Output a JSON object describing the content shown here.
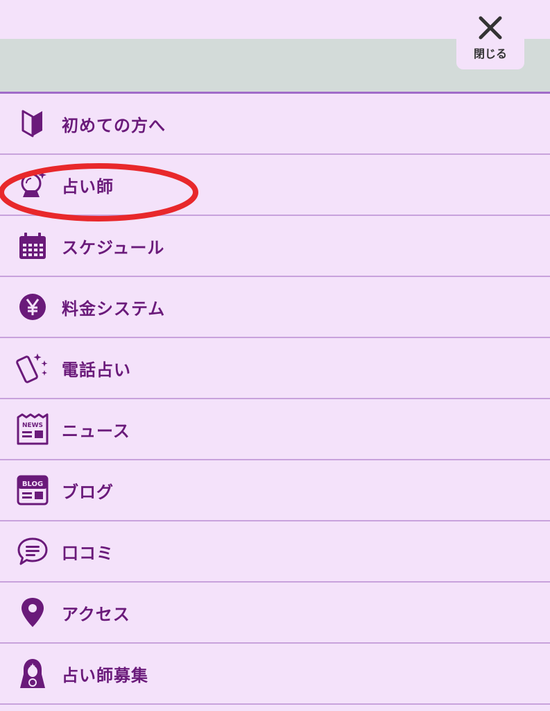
{
  "header": {
    "close_label": "閉じる"
  },
  "menu": {
    "items": [
      {
        "label": "初めての方へ",
        "icon": "beginner-mark-icon"
      },
      {
        "label": "占い師",
        "icon": "crystal-ball-icon"
      },
      {
        "label": "スケジュール",
        "icon": "calendar-icon"
      },
      {
        "label": "料金システム",
        "icon": "yen-icon"
      },
      {
        "label": "電話占い",
        "icon": "phone-sparkle-icon"
      },
      {
        "label": "ニュース",
        "icon": "news-icon"
      },
      {
        "label": "ブログ",
        "icon": "blog-icon"
      },
      {
        "label": "口コミ",
        "icon": "chat-bubble-icon"
      },
      {
        "label": "アクセス",
        "icon": "map-pin-icon"
      },
      {
        "label": "占い師募集",
        "icon": "fortune-teller-icon"
      }
    ]
  },
  "icon_texts": {
    "news": "NEWS",
    "blog": "BLOG"
  },
  "colors": {
    "background": "#f4e2fa",
    "accent": "#6a1a7a",
    "band": "#d3dbd9",
    "divider": "#c8a2dc",
    "highlight": "#e8282b"
  }
}
